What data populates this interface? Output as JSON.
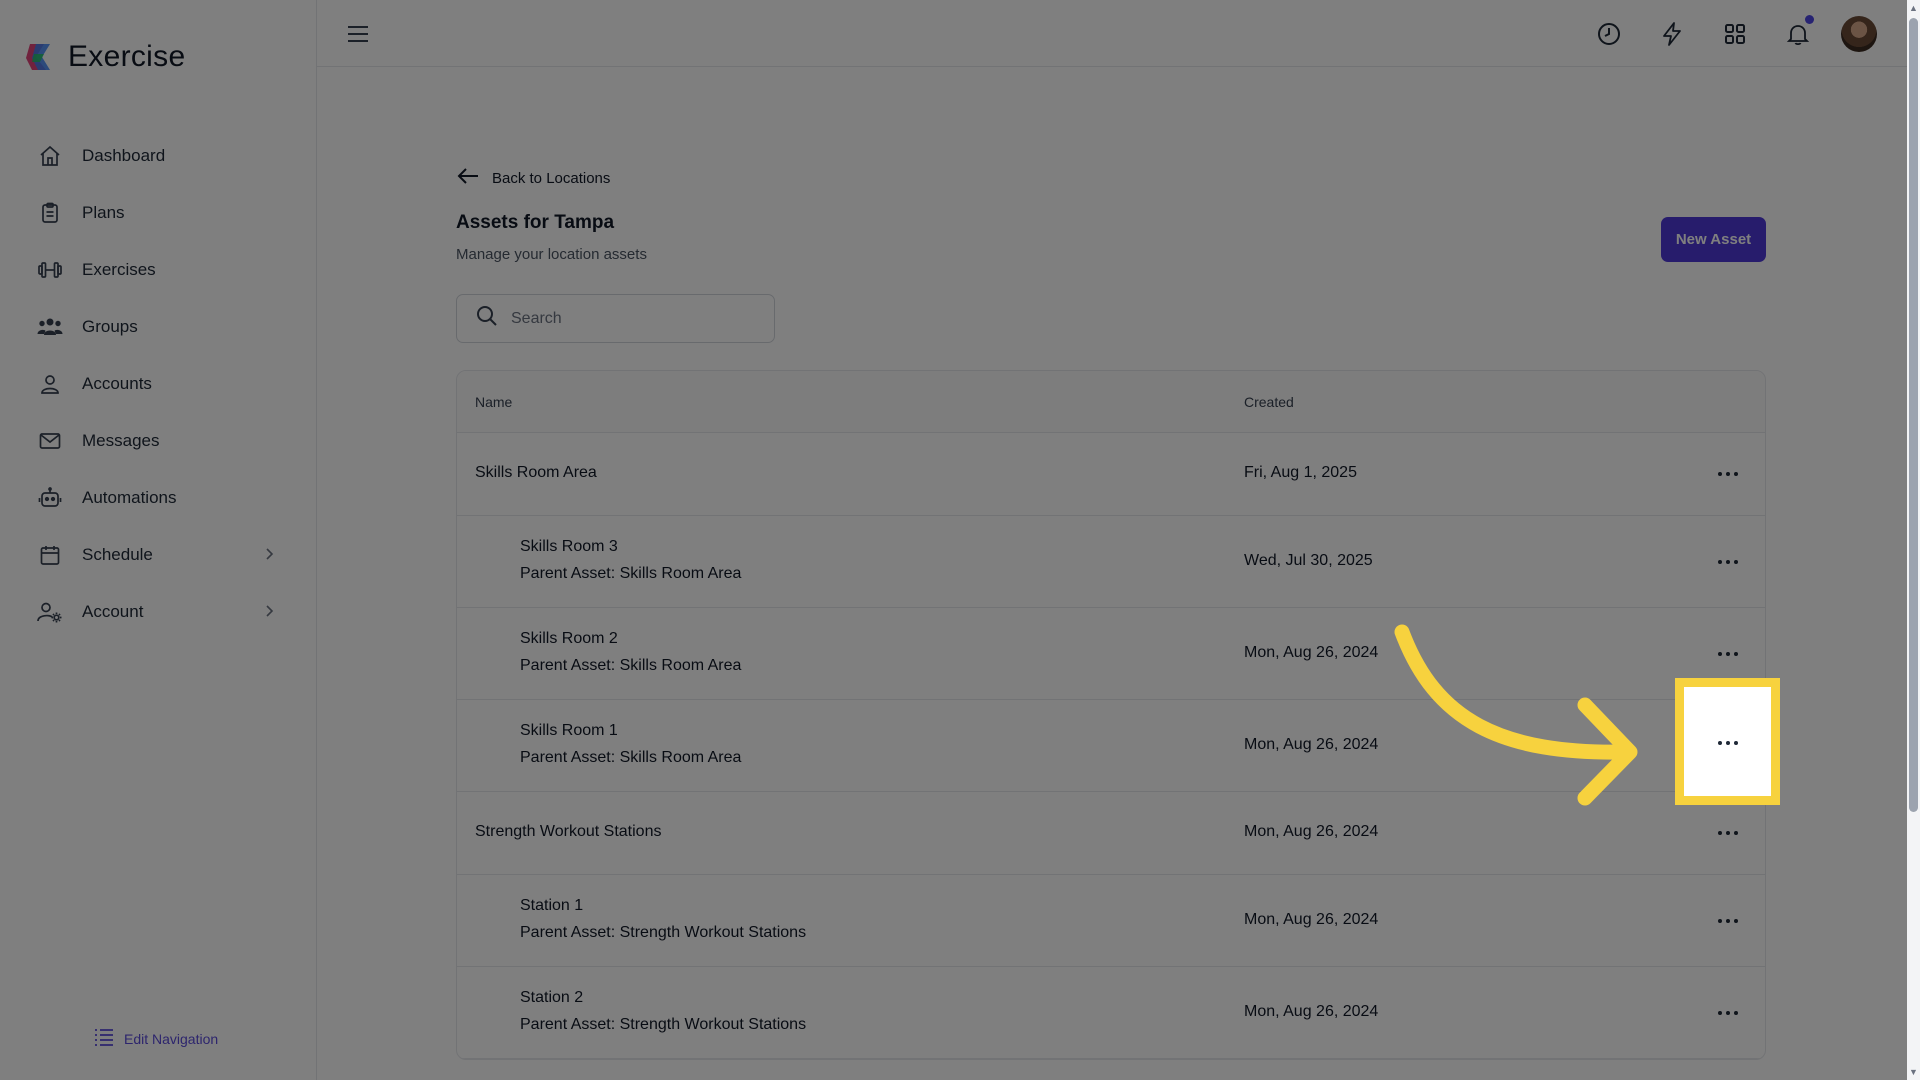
{
  "app": {
    "name": "Exercise"
  },
  "sidebar": {
    "items": [
      {
        "label": "Dashboard",
        "icon": "home-icon"
      },
      {
        "label": "Plans",
        "icon": "clipboard-icon"
      },
      {
        "label": "Exercises",
        "icon": "dumbbell-icon"
      },
      {
        "label": "Groups",
        "icon": "users-icon"
      },
      {
        "label": "Accounts",
        "icon": "user-icon"
      },
      {
        "label": "Messages",
        "icon": "mail-icon"
      },
      {
        "label": "Automations",
        "icon": "robot-icon"
      },
      {
        "label": "Schedule",
        "icon": "calendar-icon",
        "has_children": true
      },
      {
        "label": "Account",
        "icon": "user-gear-icon",
        "has_children": true
      }
    ],
    "edit_navigation": "Edit Navigation"
  },
  "topbar": {
    "icons": [
      "clock-icon",
      "bolt-icon",
      "grid-icon",
      "bell-icon"
    ],
    "notification_dot_color": "#4f46e5"
  },
  "page": {
    "back_label": "Back to Locations",
    "title": "Assets for Tampa",
    "subtitle": "Manage your location assets",
    "new_button": "New Asset",
    "search_placeholder": "Search"
  },
  "table": {
    "columns": {
      "name": "Name",
      "created": "Created"
    },
    "rows": [
      {
        "name": "Skills Room Area",
        "parent": "",
        "created": "Fri, Aug 1, 2025"
      },
      {
        "name": "Skills Room 3",
        "parent": "Parent Asset: Skills Room Area",
        "created": "Wed, Jul 30, 2025"
      },
      {
        "name": "Skills Room 2",
        "parent": "Parent Asset: Skills Room Area",
        "created": "Mon, Aug 26, 2024"
      },
      {
        "name": "Skills Room 1",
        "parent": "Parent Asset: Skills Room Area",
        "created": "Mon, Aug 26, 2024"
      },
      {
        "name": "Strength Workout Stations",
        "parent": "",
        "created": "Mon, Aug 26, 2024"
      },
      {
        "name": "Station 1",
        "parent": "Parent Asset: Strength Workout Stations",
        "created": "Mon, Aug 26, 2024"
      },
      {
        "name": "Station 2",
        "parent": "Parent Asset: Strength Workout Stations",
        "created": "Mon, Aug 26, 2024"
      }
    ]
  },
  "colors": {
    "accent": "#4f39d9",
    "highlight": "#f7d23e"
  }
}
